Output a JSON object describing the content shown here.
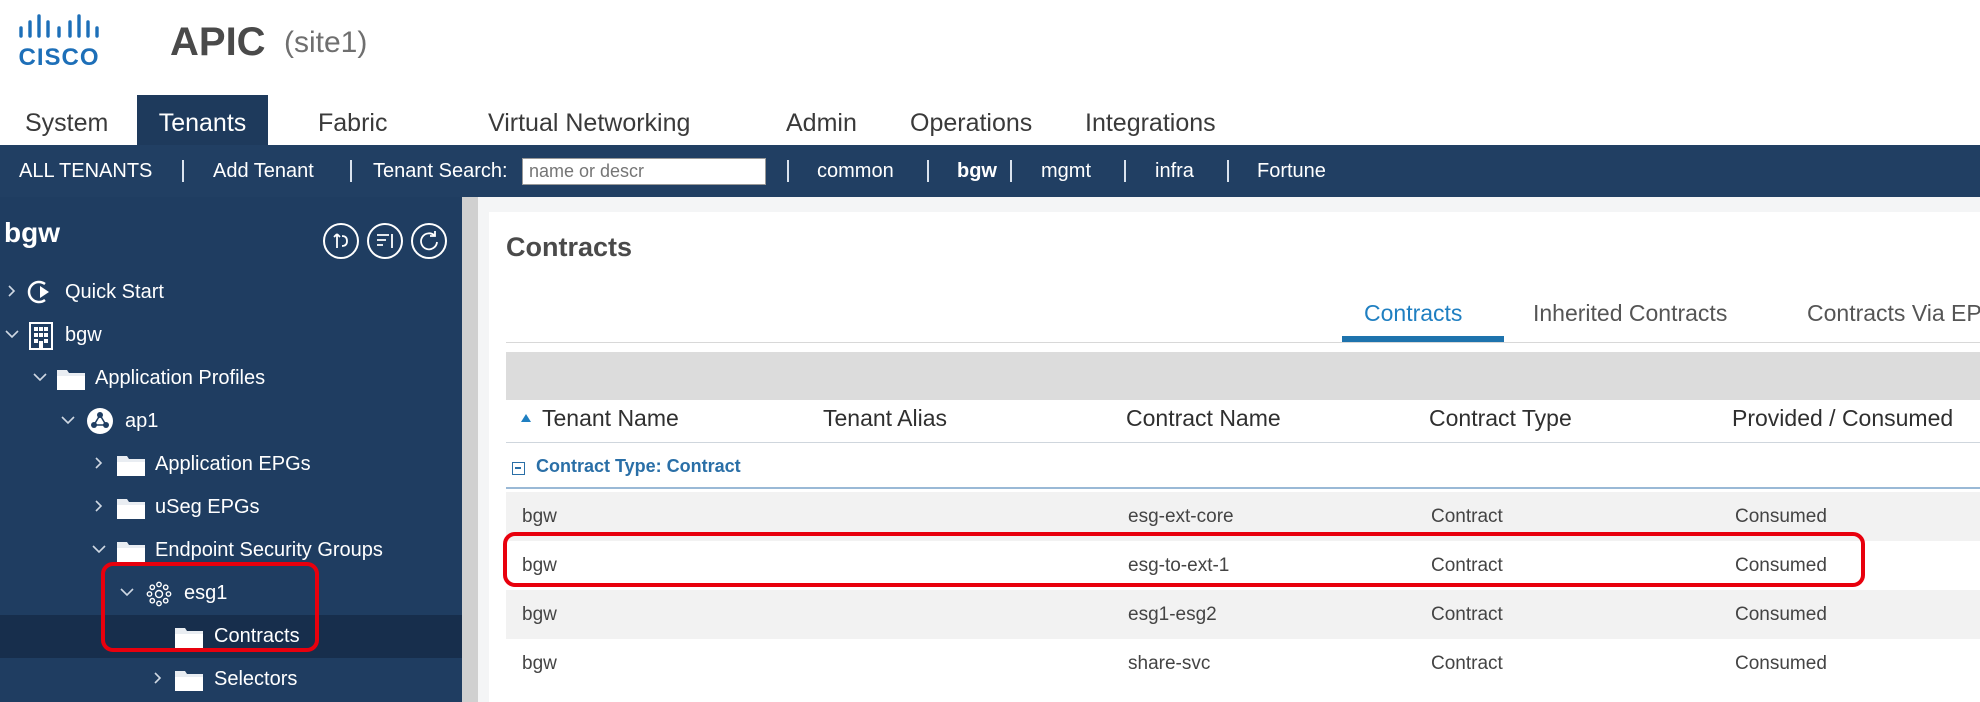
{
  "header": {
    "logo_text": "CISCO",
    "app_title": "APIC",
    "site": "(site1)"
  },
  "main_tabs": [
    "System",
    "Tenants",
    "Fabric",
    "Virtual Networking",
    "Admin",
    "Operations",
    "Integrations"
  ],
  "active_main_tab": "Tenants",
  "tenant_bar": {
    "all_tenants": "ALL TENANTS",
    "add_tenant": "Add Tenant",
    "search_label": "Tenant Search:",
    "search_placeholder": "name or descr",
    "tenants": [
      "common",
      "bgw",
      "mgmt",
      "infra",
      "Fortune"
    ],
    "active_tenant": "bgw"
  },
  "leftnav": {
    "title": "bgw",
    "toolbar_icons": [
      "back-icon",
      "list-icon",
      "refresh-icon"
    ],
    "items": [
      {
        "label": "Quick Start",
        "icon": "quick-start-icon",
        "expanded": false
      },
      {
        "label": "bgw",
        "icon": "tenant-building-icon",
        "expanded": true
      },
      {
        "label": "Application Profiles",
        "icon": "folder-icon",
        "expanded": true
      },
      {
        "label": "ap1",
        "icon": "application-profile-icon",
        "expanded": true
      },
      {
        "label": "Application EPGs",
        "icon": "folder-icon",
        "expanded": false
      },
      {
        "label": "uSeg EPGs",
        "icon": "folder-icon",
        "expanded": false
      },
      {
        "label": "Endpoint Security Groups",
        "icon": "folder-icon",
        "expanded": true
      },
      {
        "label": "esg1",
        "icon": "esg-icon",
        "expanded": true
      },
      {
        "label": "Contracts",
        "icon": "folder-icon",
        "selected": true
      },
      {
        "label": "Selectors",
        "icon": "folder-icon",
        "expanded": false
      }
    ]
  },
  "content": {
    "title": "Contracts",
    "tabs": [
      "Contracts",
      "Inherited Contracts",
      "Contracts Via EPG"
    ],
    "active_tab": "Contracts",
    "columns": [
      "Tenant Name",
      "Tenant Alias",
      "Contract Name",
      "Contract Type",
      "Provided / Consumed"
    ],
    "sort_column": "Tenant Name",
    "sort_direction": "ascending",
    "group_label": "Contract Type: Contract",
    "rows": [
      {
        "tenant": "bgw",
        "alias": "",
        "contract": "esg-ext-core",
        "type": "Contract",
        "pc": "Consumed"
      },
      {
        "tenant": "bgw",
        "alias": "",
        "contract": "esg-to-ext-1",
        "type": "Contract",
        "pc": "Consumed"
      },
      {
        "tenant": "bgw",
        "alias": "",
        "contract": "esg1-esg2",
        "type": "Contract",
        "pc": "Consumed"
      },
      {
        "tenant": "bgw",
        "alias": "",
        "contract": "share-svc",
        "type": "Contract",
        "pc": "Consumed"
      }
    ]
  },
  "colors": {
    "nav_bg": "#1f3d61",
    "tenant_bar_bg": "#213f63",
    "active_tab_bg": "#1e3a5c",
    "accent_blue": "#1f7fc1",
    "highlight_red": "#e8000d"
  }
}
